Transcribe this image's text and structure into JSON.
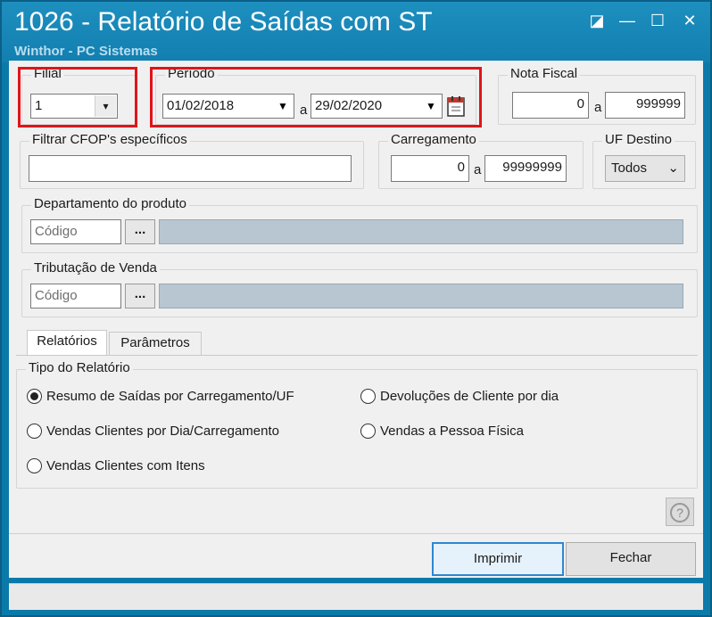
{
  "window": {
    "title": "1026 - Relatório de Saídas com ST",
    "subtitle": "Winthor - PC Sistemas",
    "controls": {
      "restore": "◪",
      "minimize": "—",
      "maximize": "☐",
      "close": "✕"
    }
  },
  "filial": {
    "label": "Filial",
    "value": "1"
  },
  "periodo": {
    "label": "Período",
    "start": "01/02/2018",
    "separator": "a",
    "end": "29/02/2020"
  },
  "nota_fiscal": {
    "label": "Nota Fiscal",
    "from": "0",
    "separator": "a",
    "to": "999999"
  },
  "cfop": {
    "label": "Filtrar CFOP's específicos",
    "value": ""
  },
  "carregamento": {
    "label": "Carregamento",
    "from": "0",
    "separator": "a",
    "to": "99999999"
  },
  "uf_destino": {
    "label": "UF Destino",
    "value": "Todos"
  },
  "departamento": {
    "label": "Departamento do produto",
    "placeholder": "Código",
    "button": "..."
  },
  "tributacao": {
    "label": "Tributação de Venda",
    "placeholder": "Código",
    "button": "..."
  },
  "tabs": [
    {
      "label": "Relatórios",
      "active": true
    },
    {
      "label": "Parâmetros",
      "active": false
    }
  ],
  "report": {
    "label": "Tipo do Relatório",
    "options": [
      {
        "label": "Resumo de Saídas por Carregamento/UF",
        "selected": true
      },
      {
        "label": "Vendas Clientes por Dia/Carregamento",
        "selected": false
      },
      {
        "label": "Vendas Clientes com Itens",
        "selected": false
      },
      {
        "label": "Devoluções de Cliente por dia",
        "selected": false
      },
      {
        "label": "Vendas a Pessoa Física",
        "selected": false
      }
    ]
  },
  "help": {
    "icon": "?"
  },
  "buttons": {
    "print": "Imprimir",
    "close": "Fechar"
  },
  "colors": {
    "titlebar": "#127fb0",
    "highlight": "#e0141a",
    "lookup": "#b8c6d2"
  }
}
